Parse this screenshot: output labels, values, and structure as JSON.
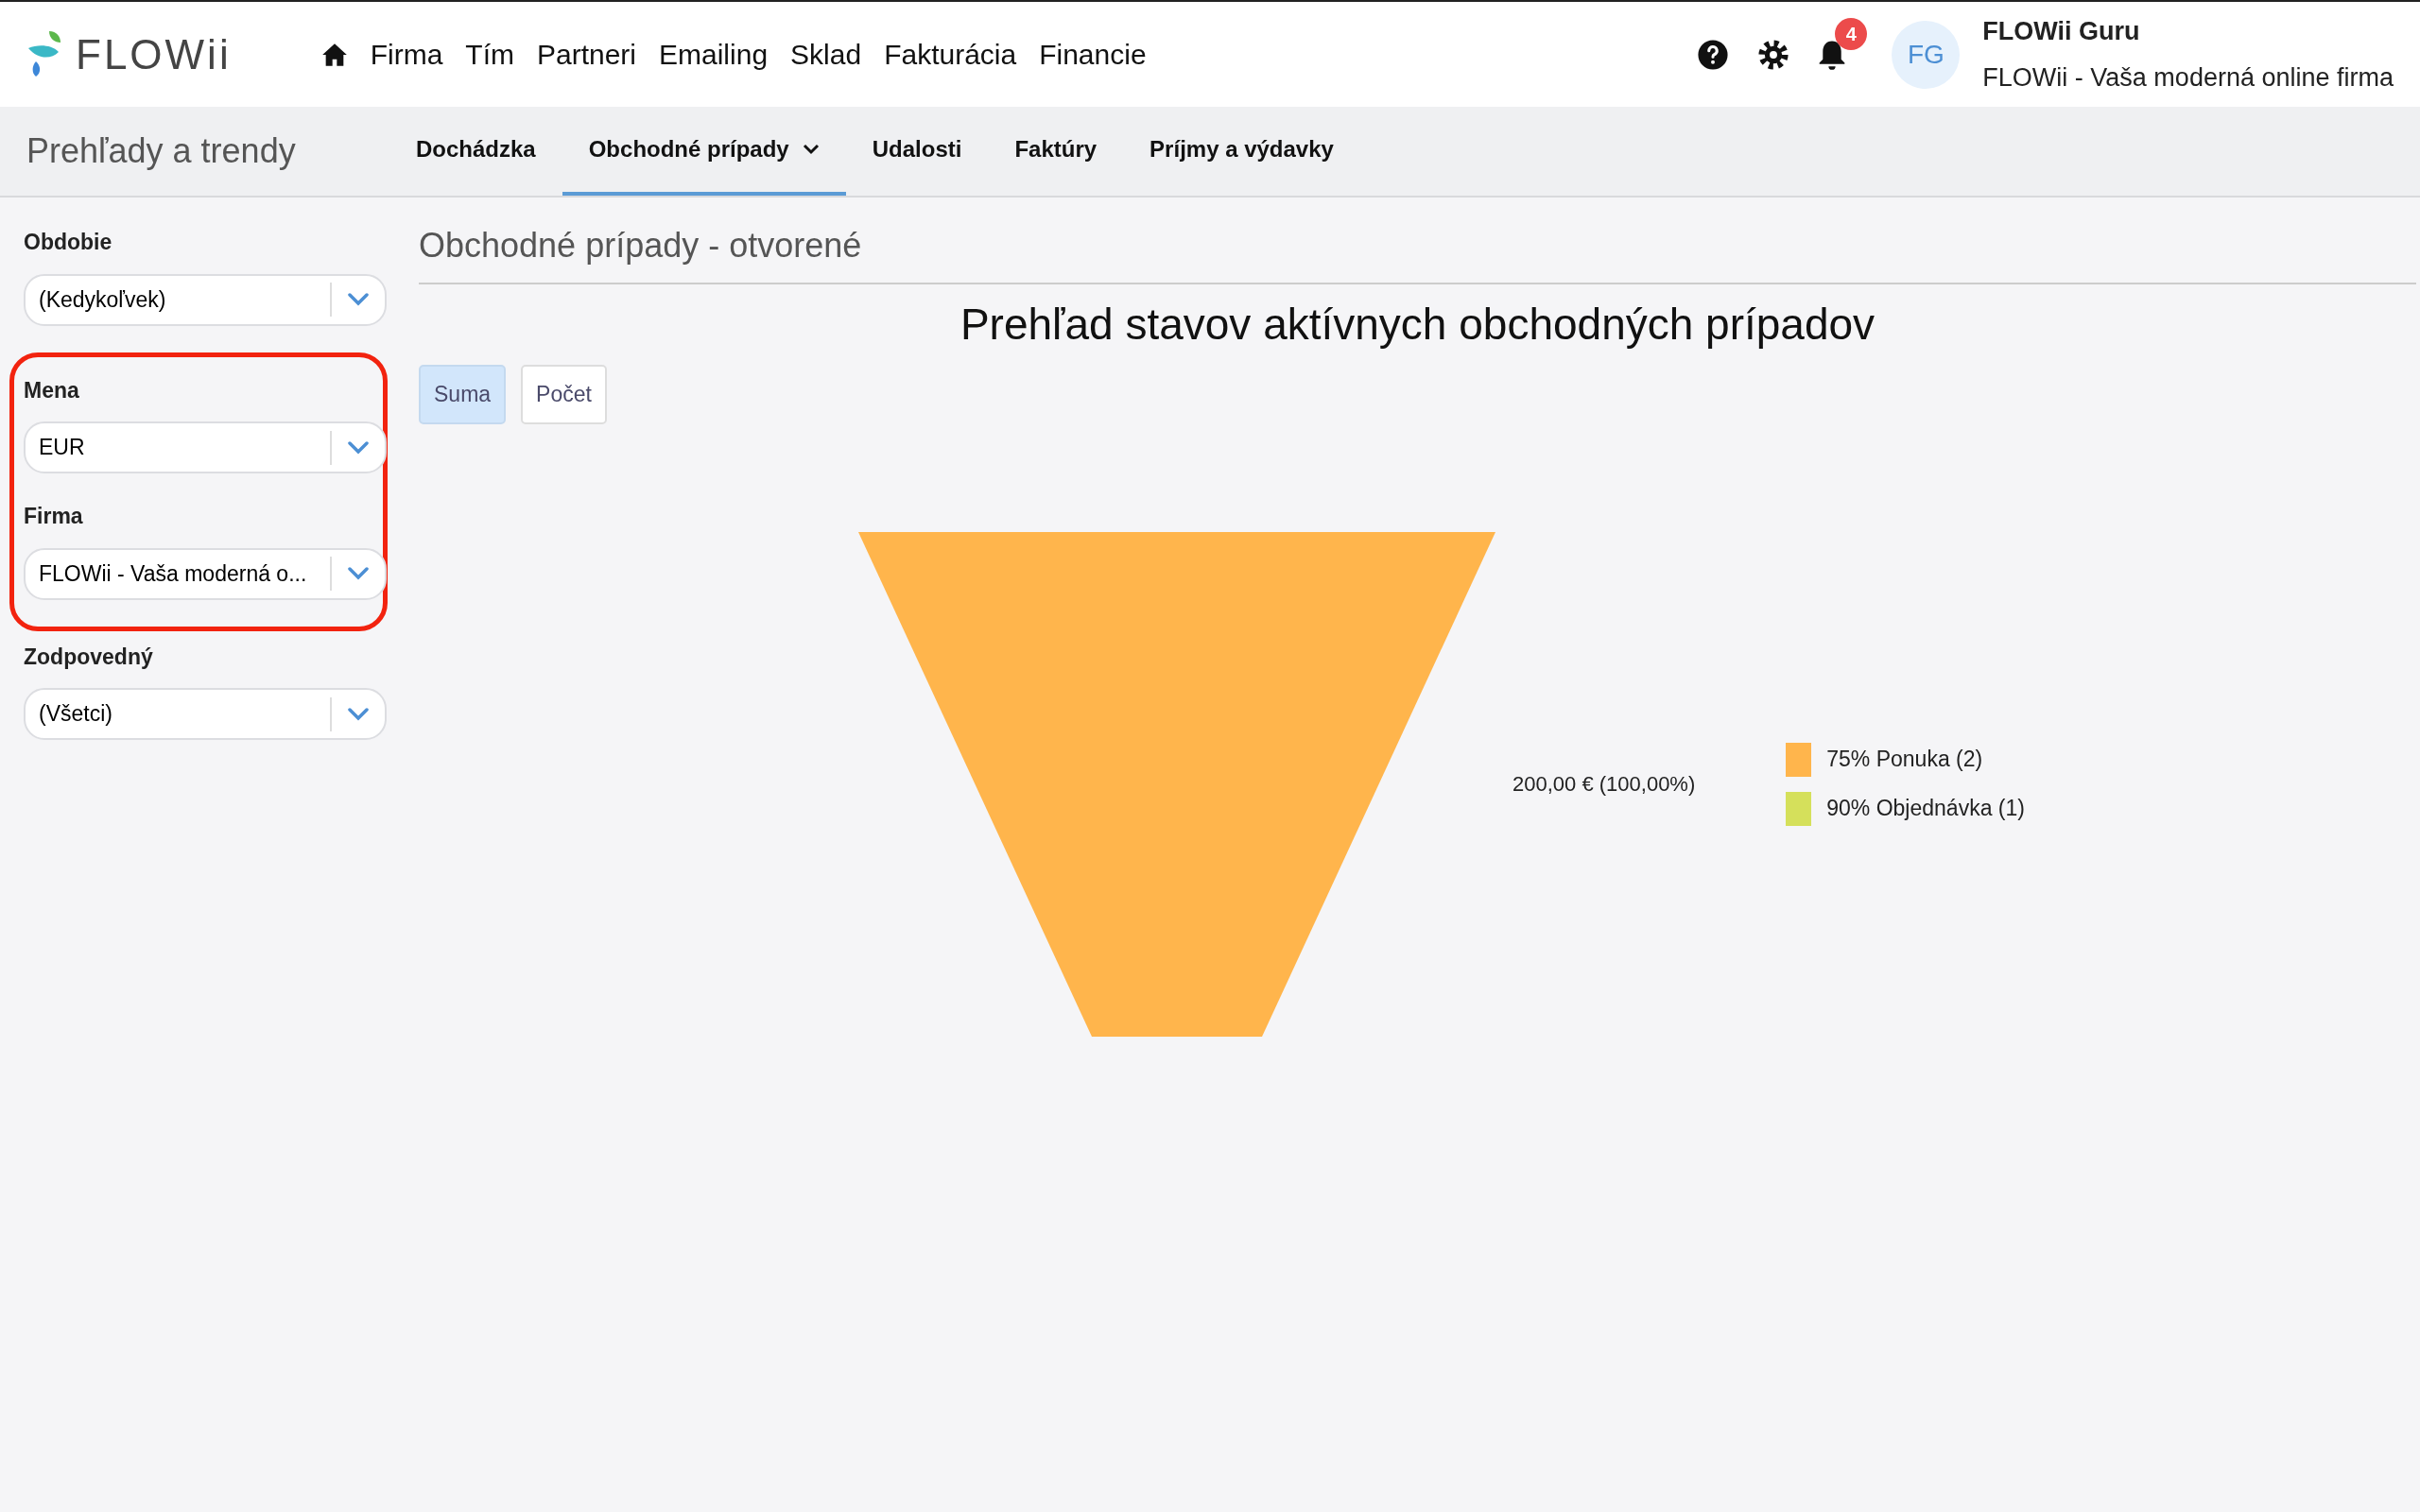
{
  "logo": {
    "text": "FLOWii"
  },
  "nav": [
    {
      "label": "Firma"
    },
    {
      "label": "Tím"
    },
    {
      "label": "Partneri"
    },
    {
      "label": "Emailing"
    },
    {
      "label": "Sklad"
    },
    {
      "label": "Fakturácia"
    },
    {
      "label": "Financie"
    }
  ],
  "notifications": {
    "count": "4"
  },
  "user": {
    "initials": "FG",
    "name": "FLOWii Guru",
    "company": "FLOWii - Vaša moderná online firma"
  },
  "section_title": "Prehľady a trendy",
  "tabs": [
    {
      "label": "Dochádzka",
      "selected": false,
      "dropdown": false
    },
    {
      "label": "Obchodné prípady",
      "selected": true,
      "dropdown": true
    },
    {
      "label": "Udalosti",
      "selected": false,
      "dropdown": false
    },
    {
      "label": "Faktúry",
      "selected": false,
      "dropdown": false
    },
    {
      "label": "Príjmy a výdavky",
      "selected": false,
      "dropdown": false
    }
  ],
  "filters": [
    {
      "label": "Obdobie",
      "value": "(Kedykoľvek)",
      "highlighted": false
    },
    {
      "label": "Mena",
      "value": "EUR",
      "highlighted": true
    },
    {
      "label": "Firma",
      "value": "FLOWii - Vaša moderná o...",
      "highlighted": true
    },
    {
      "label": "Zodpovedný",
      "value": "(Všetci)",
      "highlighted": false
    }
  ],
  "report": {
    "title": "Obchodné prípady - otvorené",
    "chart_title": "Prehľad stavov aktívnych obchodných prípadov",
    "modes": [
      {
        "label": "Suma",
        "selected": true
      },
      {
        "label": "Počet",
        "selected": false
      }
    ],
    "funnel_label": "200,00 € (100,00%)",
    "legend": [
      {
        "label": "75% Ponuka (2)",
        "color": "#ffb54c"
      },
      {
        "label": "90% Objednávka (1)",
        "color": "#d5e05b"
      }
    ]
  }
}
